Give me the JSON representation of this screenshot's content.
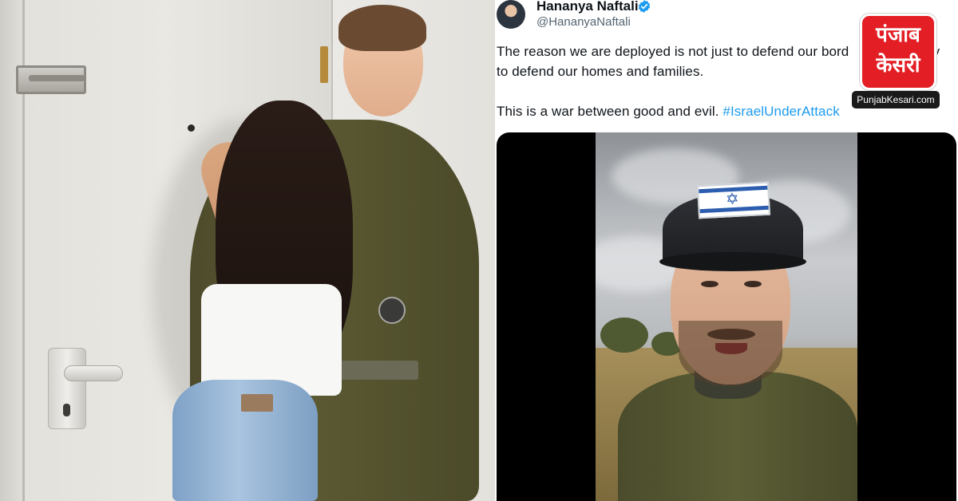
{
  "tweet": {
    "author_name": "Hananya Naftali",
    "author_handle": "@HananyaNaftali",
    "text_line1": "The reason we are deployed is not just to defend our bord",
    "text_line1_end": "ally",
    "text_line2": "to defend our homes and families.",
    "text_line3": "This is a war between good and evil.",
    "hashtag": "#IsraelUnderAttack"
  },
  "logo": {
    "line1": "पंजाब",
    "line2": "केसरी",
    "badge": "PunjabKesari.com"
  },
  "icons": {
    "verified": "verified-badge-icon",
    "flag_star": "star-of-david-icon"
  },
  "colors": {
    "link": "#1d9bf0",
    "brand_red": "#e31e24",
    "verified_blue": "#1d9bf0"
  }
}
